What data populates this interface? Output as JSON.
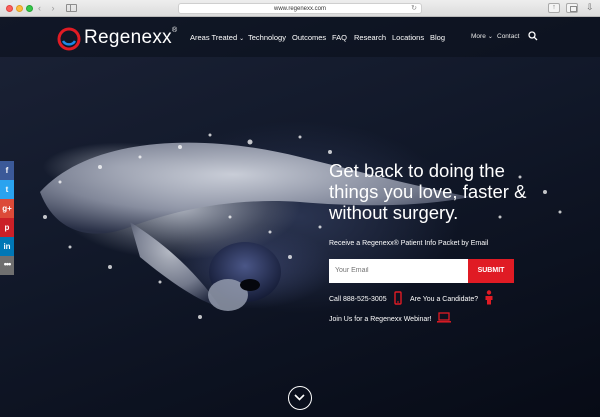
{
  "browser": {
    "url": "www.regenexx.com"
  },
  "header": {
    "brand": "Regenexx",
    "brand_mark": "®",
    "nav": [
      {
        "label": "Areas Treated",
        "has_dropdown": true
      },
      {
        "label": "Technology"
      },
      {
        "label": "Outcomes"
      },
      {
        "label": "FAQ"
      },
      {
        "label": "Research"
      },
      {
        "label": "Locations"
      },
      {
        "label": "Blog"
      }
    ],
    "secondary_nav": [
      {
        "label": "More",
        "has_dropdown": true
      },
      {
        "label": "Contact"
      }
    ],
    "search_icon": "search-icon"
  },
  "hero": {
    "headline_lines": [
      "Get back to doing the",
      "things you love, faster &",
      "without surgery."
    ],
    "subcopy": "Receive a Regenexx® Patient Info Packet by Email",
    "email_placeholder": "Your Email",
    "submit_label": "SUBMIT",
    "call_label": "Call 888-525-3005",
    "candidate_label": "Are You a Candidate?",
    "webinar_label": "Join Us for a Regenexx Webinar!"
  },
  "share_bar": {
    "items": [
      {
        "icon": "facebook-icon",
        "glyph": "f"
      },
      {
        "icon": "twitter-icon",
        "glyph": "t"
      },
      {
        "icon": "google-plus-icon",
        "glyph": "g+"
      },
      {
        "icon": "pinterest-icon",
        "glyph": "p"
      },
      {
        "icon": "linkedin-icon",
        "glyph": "in"
      },
      {
        "icon": "more-icon",
        "glyph": "•••"
      }
    ]
  },
  "colors": {
    "accent_red": "#e01b24",
    "hero_dark": "#0d1220"
  }
}
